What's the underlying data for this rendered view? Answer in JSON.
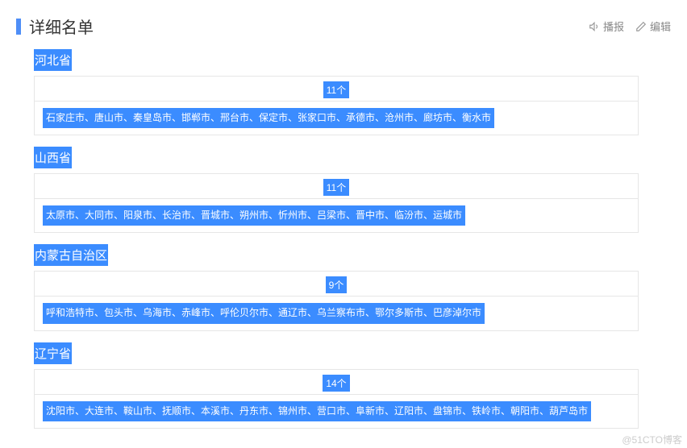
{
  "header": {
    "title": "详细名单",
    "actions": {
      "broadcast": "播报",
      "edit": "编辑"
    }
  },
  "provinces": [
    {
      "name": "河北省",
      "count": "11个",
      "cities": "石家庄市、唐山市、秦皇岛市、邯郸市、邢台市、保定市、张家口市、承德市、沧州市、廊坊市、衡水市"
    },
    {
      "name": "山西省",
      "count": "11个",
      "cities": "太原市、大同市、阳泉市、长治市、晋城市、朔州市、忻州市、吕梁市、晋中市、临汾市、运城市"
    },
    {
      "name": "内蒙古自治区",
      "count": "9个",
      "cities": "呼和浩特市、包头市、乌海市、赤峰市、呼伦贝尔市、通辽市、乌兰察布市、鄂尔多斯市、巴彦淖尔市"
    },
    {
      "name": "辽宁省",
      "count": "14个",
      "cities": "沈阳市、大连市、鞍山市、抚顺市、本溪市、丹东市、锦州市、营口市、阜新市、辽阳市、盘锦市、铁岭市、朝阳市、葫芦岛市"
    }
  ],
  "watermark": "@51CTO博客"
}
